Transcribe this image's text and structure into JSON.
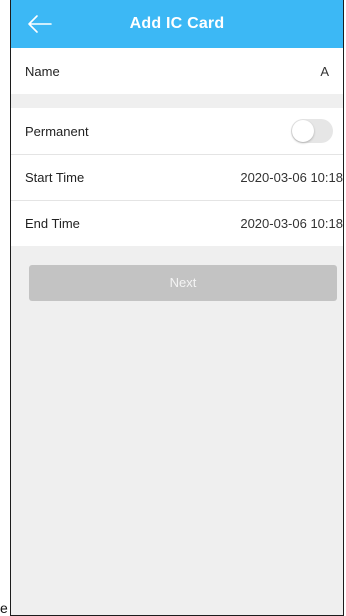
{
  "header": {
    "title": "Add IC Card",
    "back_icon": "arrow-left-icon",
    "background": "#3cb8f5"
  },
  "name_section": {
    "name_label": "Name",
    "name_value": "A"
  },
  "validity_section": {
    "permanent_label": "Permanent",
    "permanent_enabled": false,
    "start_label": "Start Time",
    "start_value": "2020-03-06 10:18",
    "end_label": "End Time",
    "end_value": "2020-03-06 10:18"
  },
  "actions": {
    "next_label": "Next",
    "next_enabled": false
  },
  "edge_text": "e"
}
